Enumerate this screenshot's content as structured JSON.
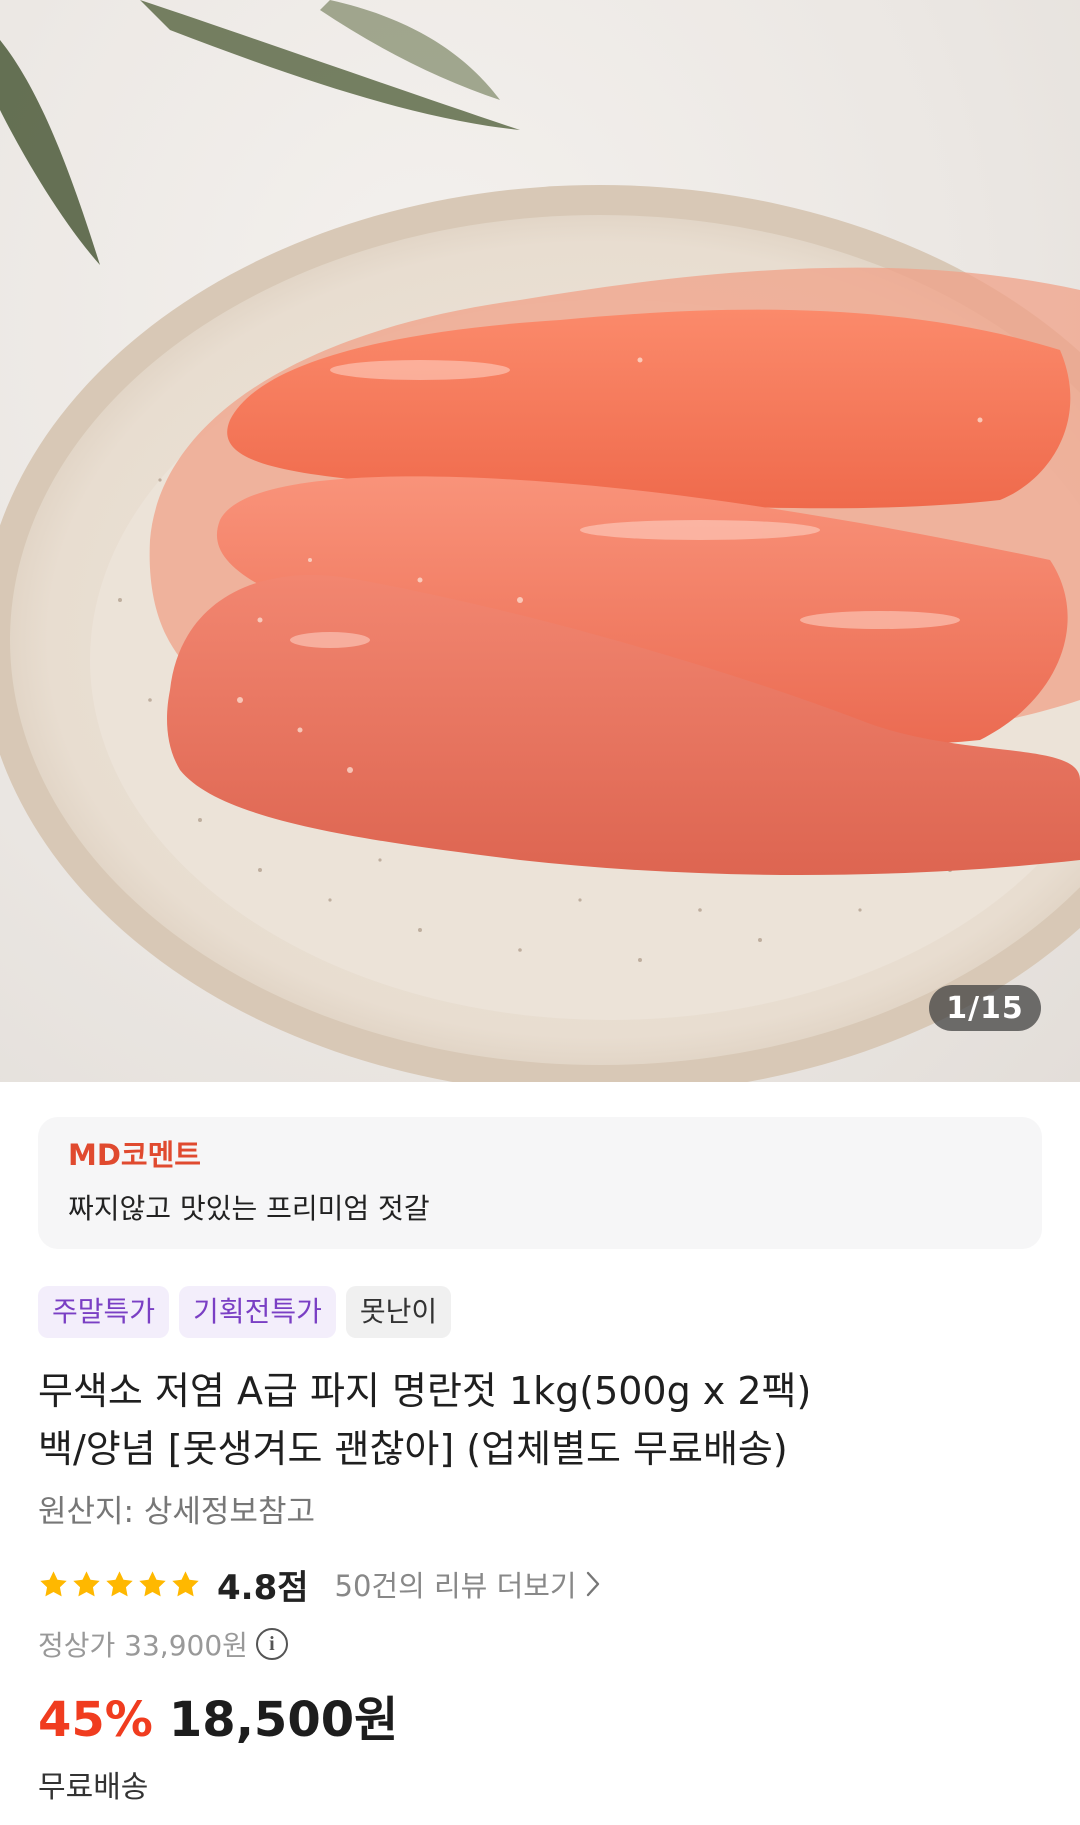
{
  "gallery": {
    "counter": "1/15",
    "image_description_icon": "product-photo"
  },
  "md_comment": {
    "title": "MD코멘트",
    "text": "짜지않고 맛있는 프리미엄 젓갈"
  },
  "tags": [
    {
      "label": "주말특가",
      "style": "purple"
    },
    {
      "label": "기획전특가",
      "style": "purple"
    },
    {
      "label": "못난이",
      "style": "gray"
    }
  ],
  "product": {
    "title_line1": "무색소 저염 A급 파지 명란젓 1kg(500g x 2팩)",
    "title_line2": "백/양념 [못생겨도 괜찮아] (업체별도 무료배송)",
    "origin": "원산지: 상세정보참고"
  },
  "rating": {
    "stars": 5,
    "score": "4.8점",
    "review_link": "50건의 리뷰 더보기"
  },
  "pricing": {
    "original": "정상가 33,900원",
    "discount": "45%",
    "price": "18,500원"
  },
  "shipping": "무료배송",
  "colors": {
    "accent_red": "#f03c1f",
    "md_title": "#e04a2f",
    "tag_purple": "#7a3fc4",
    "star": "#ffb800"
  }
}
